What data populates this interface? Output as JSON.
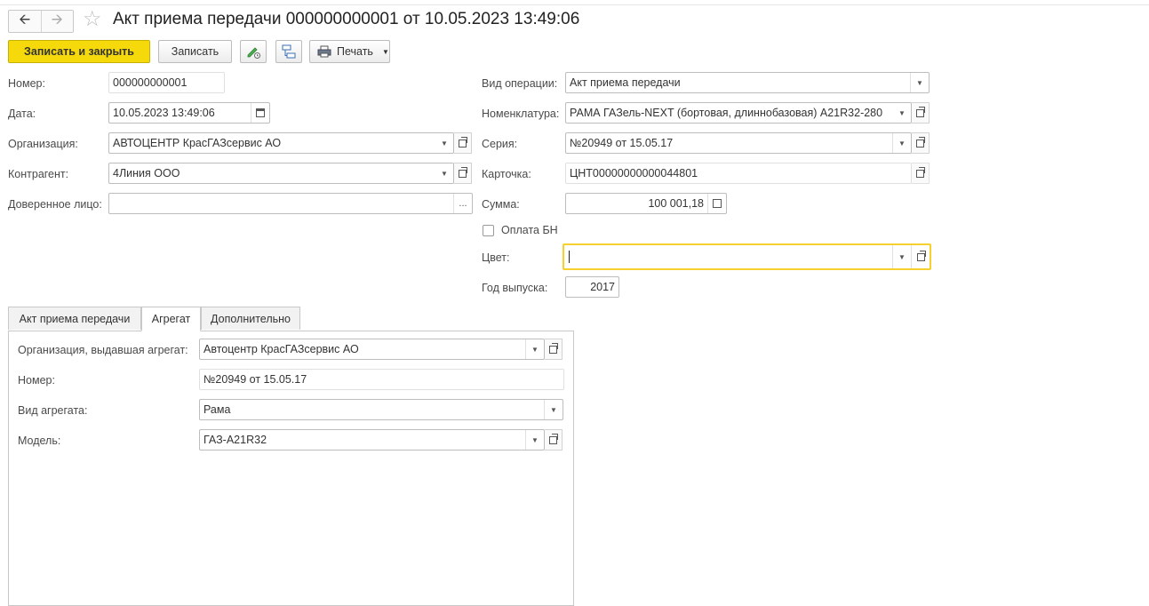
{
  "header": {
    "back_icon": "arrow-left-icon",
    "forward_icon": "arrow-right-icon",
    "star_icon": "star-icon",
    "title": "Акт приема передачи 000000000001 от 10.05.2023 13:49:06"
  },
  "toolbar": {
    "save_close_label": "Записать и закрыть",
    "save_label": "Записать",
    "print_label": "Печать"
  },
  "form": {
    "number": {
      "label": "Номер:",
      "value": "000000000001"
    },
    "date": {
      "label": "Дата:",
      "value": "10.05.2023 13:49:06"
    },
    "organization": {
      "label": "Организация:",
      "value": "АВТОЦЕНТР КрасГАЗсервис АО"
    },
    "counterparty": {
      "label": "Контрагент:",
      "value": "4Линия ООО"
    },
    "trustee": {
      "label": "Доверенное лицо:",
      "value": ""
    },
    "operation": {
      "label": "Вид операции:",
      "value": "Акт приема передачи"
    },
    "nomenclature": {
      "label": "Номенклатура:",
      "value": "РАМА ГАЗель-NEXT (бортовая, длиннобазовая) А21R32-280"
    },
    "series": {
      "label": "Серия:",
      "value": "№20949 от 15.05.17"
    },
    "card": {
      "label": "Карточка:",
      "value": "ЦНТ00000000000044801"
    },
    "sum": {
      "label": "Сумма:",
      "value": "100 001,18"
    },
    "cashless": {
      "label": "Оплата БН",
      "checked": false
    },
    "color": {
      "label": "Цвет:",
      "value": ""
    },
    "year": {
      "label": "Год выпуска:",
      "value": "2017"
    }
  },
  "tabs": [
    {
      "label": "Акт приема передачи",
      "active": false
    },
    {
      "label": "Агрегат",
      "active": true
    },
    {
      "label": "Дополнительно",
      "active": false
    }
  ],
  "aggregate": {
    "org": {
      "label": "Организация, выдавшая агрегат:",
      "value": "Автоцентр КрасГАЗсервис АО"
    },
    "number": {
      "label": "Номер:",
      "value": "№20949 от 15.05.17"
    },
    "kind": {
      "label": "Вид агрегата:",
      "value": "Рама"
    },
    "model": {
      "label": "Модель:",
      "value": "ГАЗ-А21R32"
    }
  },
  "colors": {
    "primary_button": "#f5d90b",
    "focus_border": "#f5d02e"
  }
}
